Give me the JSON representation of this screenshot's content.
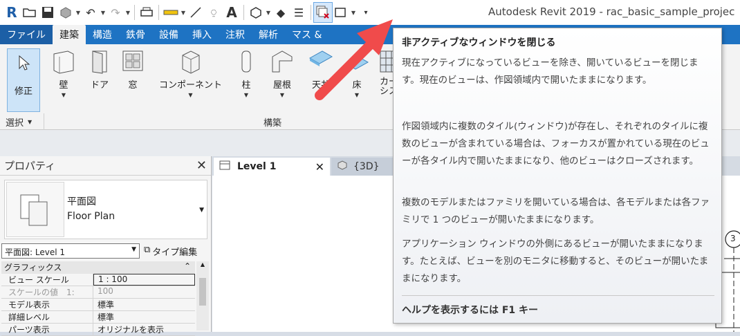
{
  "app_title": "Autodesk Revit 2019 - rac_basic_sample_projec",
  "qat": {
    "icons": [
      "revit-logo-icon",
      "open-icon",
      "save-icon",
      "sync-icon",
      "undo-icon",
      "redo-icon",
      "print-icon",
      "measure-icon",
      "dimension-icon",
      "tag-icon",
      "text-icon",
      "3d-view-icon",
      "section-icon",
      "thin-lines-icon",
      "close-inactive-windows-icon",
      "switch-windows-icon",
      "customize-icon"
    ]
  },
  "ribbon_tabs": [
    "ファイル",
    "建築",
    "構造",
    "鉄骨",
    "設備",
    "挿入",
    "注釈",
    "解析",
    "マス &"
  ],
  "ribbon": {
    "modify_label": "修正",
    "tools": [
      "壁",
      "ドア",
      "窓",
      "コンポーネント",
      "柱",
      "屋根",
      "天井",
      "床",
      "カー\nシス"
    ],
    "panel_select_label": "選択",
    "panel_build_label": "構築"
  },
  "properties": {
    "title": "プロパティ",
    "type_name_ja": "平面図",
    "type_name_en": "Floor Plan",
    "instance_select": "平面図: Level 1",
    "edit_type_label": "タイプ編集",
    "category": "グラフィックス",
    "rows": [
      {
        "key": "ビュー スケール",
        "value": "1 : 100"
      },
      {
        "key": "スケールの値　1:",
        "value": "100"
      },
      {
        "key": "モデル表示",
        "value": "標準"
      },
      {
        "key": "詳細レベル",
        "value": "標準"
      },
      {
        "key": "パーツ表示",
        "value": "オリジナルを表示"
      }
    ]
  },
  "view_tabs": {
    "active": "Level 1",
    "inactive": "{3D}"
  },
  "tooltip": {
    "title": "非アクティブなウィンドウを閉じる",
    "paragraphs": [
      "現在アクティブになっているビューを除き、開いているビューを閉じます。現在のビューは、作図領域内で開いたままになります。",
      "作図領域内に複数のタイル(ウィンドウ)が存在し、それぞれのタイルに複数のビューが含まれている場合は、フォーカスが置かれている現在のビューが各タイル内で開いたままになり、他のビューはクローズされます。",
      "複数のモデルまたはファミリを開いている場合は、各モデルまたは各ファミリで 1 つのビューが開いたままになります。",
      "アプリケーション ウィンドウの外側にあるビューが開いたままになります。たとえば、ビューを別のモニタに移動すると、そのビューが開いたままになります。"
    ],
    "help": "ヘルプを表示するには F1 キー"
  },
  "canvas_tag": "3"
}
